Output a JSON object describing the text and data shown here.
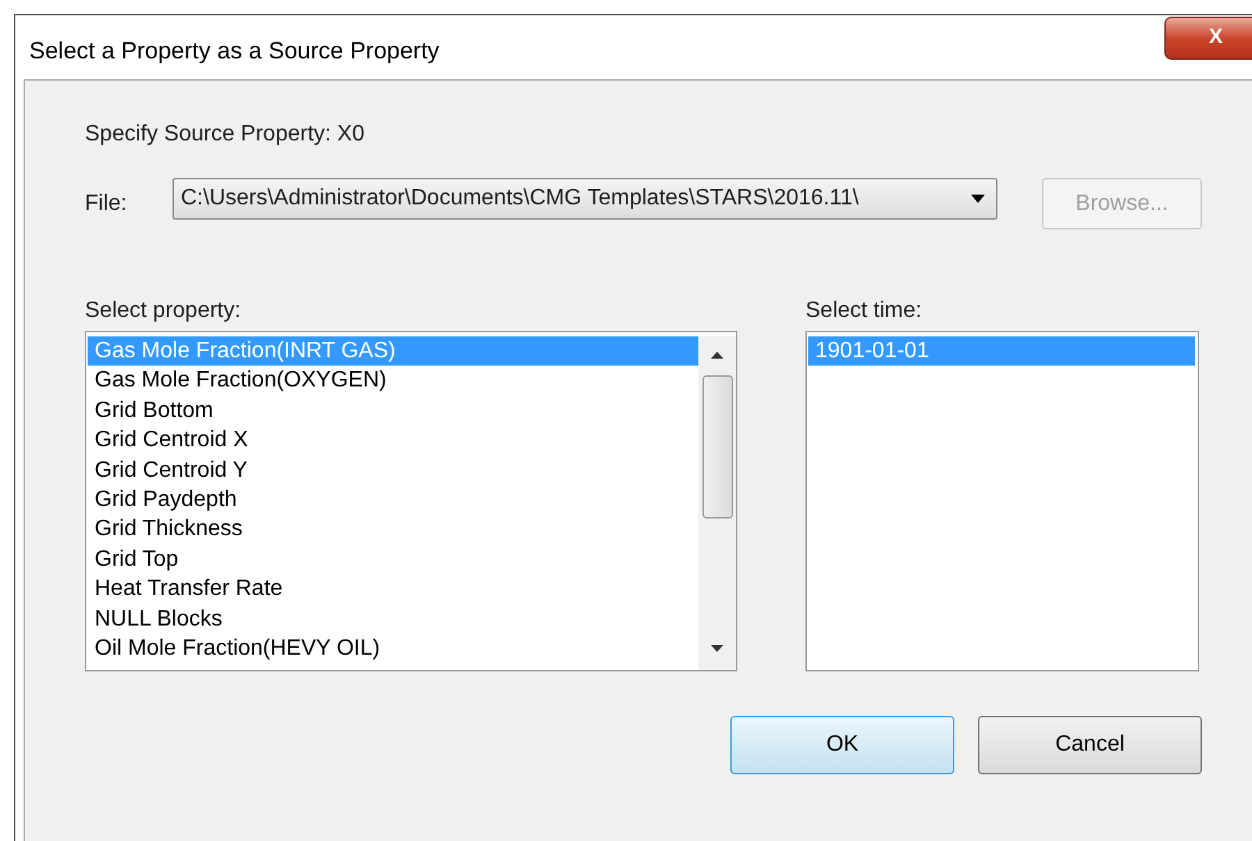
{
  "window": {
    "title": "Select a Property as a Source Property",
    "close": "X"
  },
  "source_label": "Specify Source Property: X0",
  "file": {
    "label": "File:",
    "value": "C:\\Users\\Administrator\\Documents\\CMG Templates\\STARS\\2016.11\\",
    "browse": {
      "label": "Browse...",
      "disabled": true
    }
  },
  "property_list": {
    "label": "Select property:",
    "items": [
      {
        "label": "Gas Mole Fraction(INRT GAS)",
        "selected": true
      },
      {
        "label": "Gas Mole Fraction(OXYGEN)",
        "selected": false
      },
      {
        "label": "Grid Bottom",
        "selected": false
      },
      {
        "label": "Grid Centroid X",
        "selected": false
      },
      {
        "label": "Grid Centroid Y",
        "selected": false
      },
      {
        "label": "Grid Paydepth",
        "selected": false
      },
      {
        "label": "Grid Thickness",
        "selected": false
      },
      {
        "label": "Grid Top",
        "selected": false
      },
      {
        "label": "Heat Transfer Rate",
        "selected": false
      },
      {
        "label": "NULL Blocks",
        "selected": false
      },
      {
        "label": "Oil Mole Fraction(HEVY OIL)",
        "selected": false
      }
    ]
  },
  "time_list": {
    "label": "Select time:",
    "items": [
      {
        "label": "1901-01-01",
        "selected": true
      }
    ]
  },
  "buttons": [
    {
      "label": "OK",
      "default": true
    },
    {
      "label": "Cancel",
      "default": false
    }
  ]
}
